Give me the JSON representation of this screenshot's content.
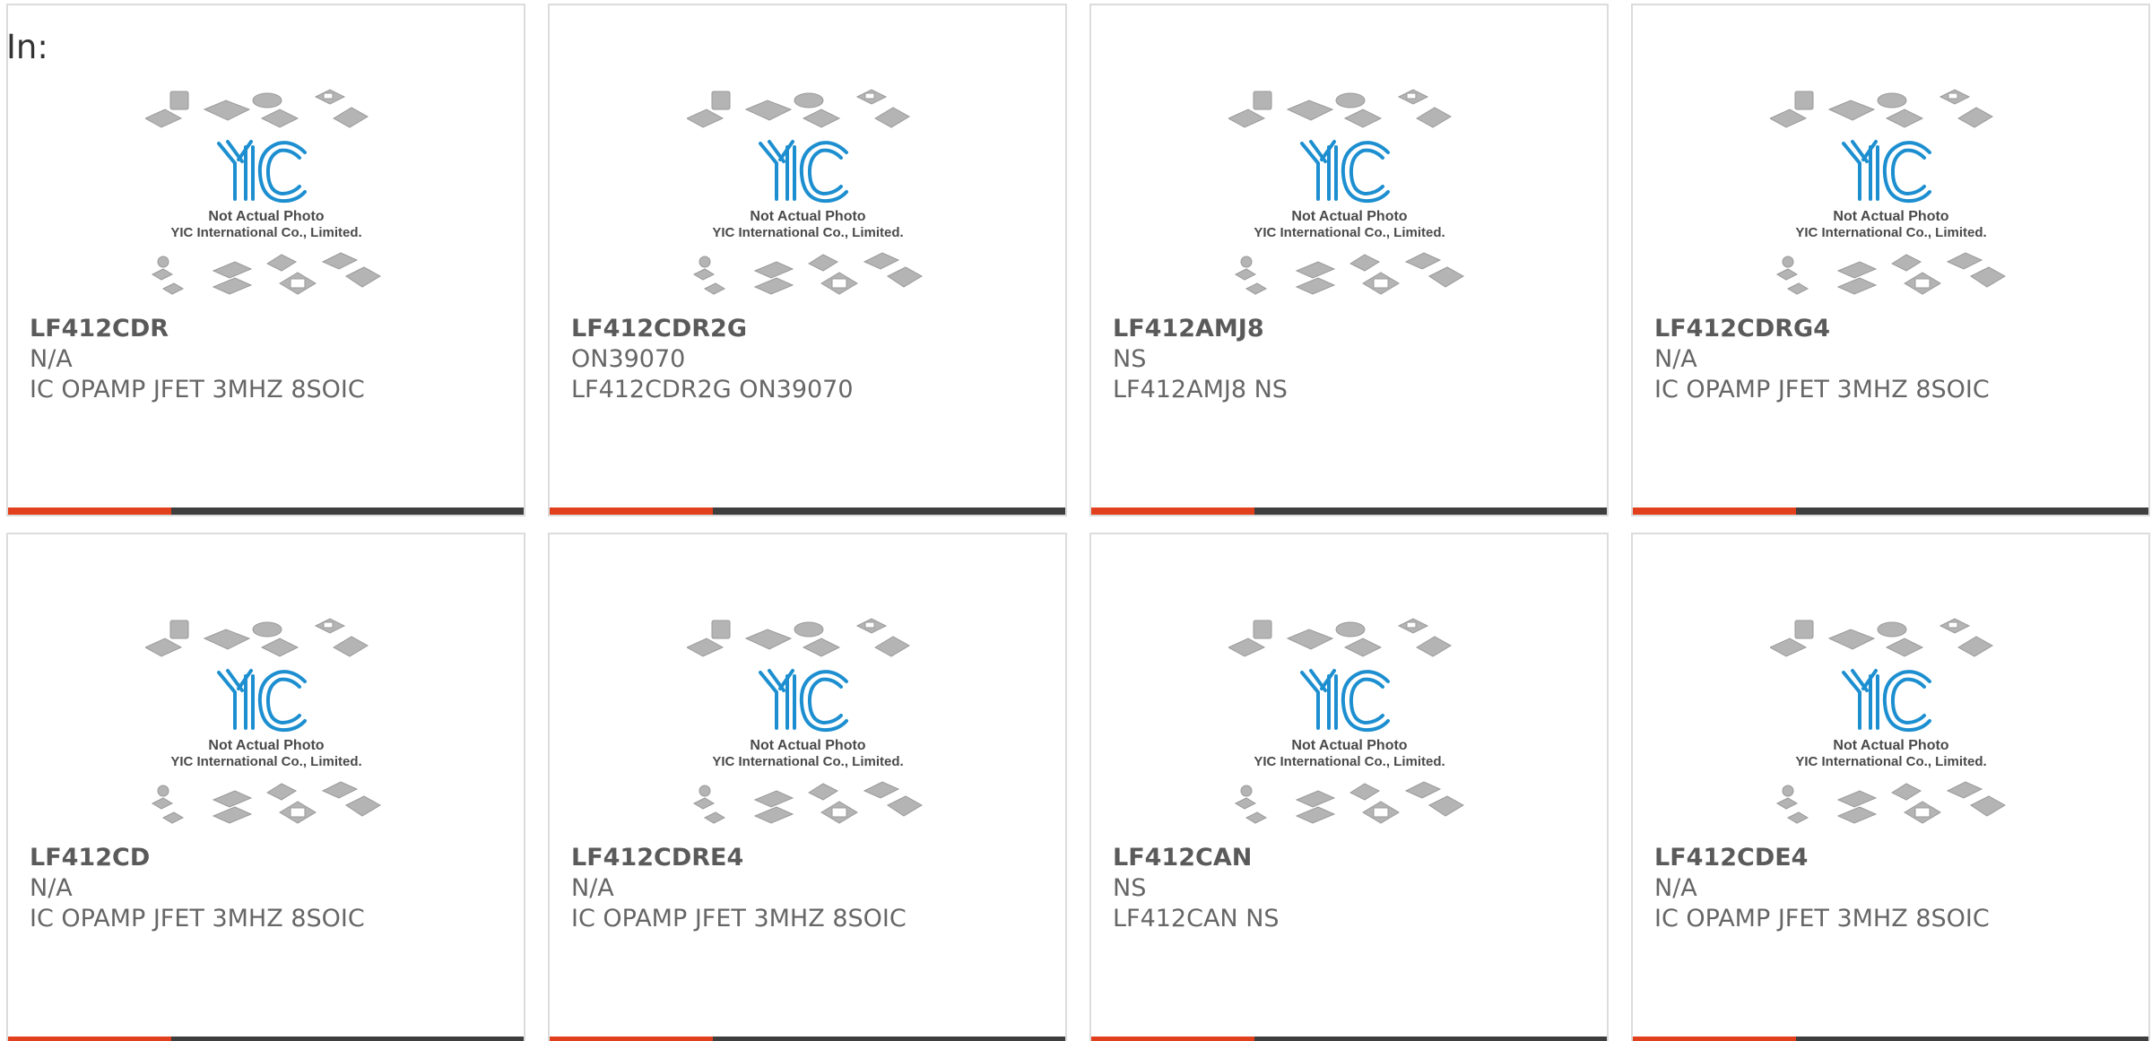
{
  "header": {
    "label": "In:"
  },
  "thumbnail": {
    "logo": "YIC",
    "caption_line1": "Not Actual Photo",
    "caption_line2": "YIC International Co., Limited.",
    "logo_color": "#1d8fd0",
    "chip_color": "#b4b4b4"
  },
  "colors": {
    "accent_bar": "#e2401c",
    "dark_bar": "#3e3e3e",
    "card_border": "#dcdcdc",
    "text": "#666666"
  },
  "products": [
    {
      "part": "LF412CDR",
      "manufacturer": "N/A",
      "description": "IC OPAMP JFET 3MHZ 8SOIC"
    },
    {
      "part": "LF412CDR2G",
      "manufacturer": "ON39070",
      "description": "LF412CDR2G ON39070"
    },
    {
      "part": "LF412AMJ8",
      "manufacturer": "NS",
      "description": "LF412AMJ8 NS"
    },
    {
      "part": "LF412CDRG4",
      "manufacturer": "N/A",
      "description": "IC OPAMP JFET 3MHZ 8SOIC"
    },
    {
      "part": "LF412CD",
      "manufacturer": "N/A",
      "description": "IC OPAMP JFET 3MHZ 8SOIC"
    },
    {
      "part": "LF412CDRE4",
      "manufacturer": "N/A",
      "description": "IC OPAMP JFET 3MHZ 8SOIC"
    },
    {
      "part": "LF412CAN",
      "manufacturer": "NS",
      "description": "LF412CAN NS"
    },
    {
      "part": "LF412CDE4",
      "manufacturer": "N/A",
      "description": "IC OPAMP JFET 3MHZ 8SOIC"
    }
  ]
}
